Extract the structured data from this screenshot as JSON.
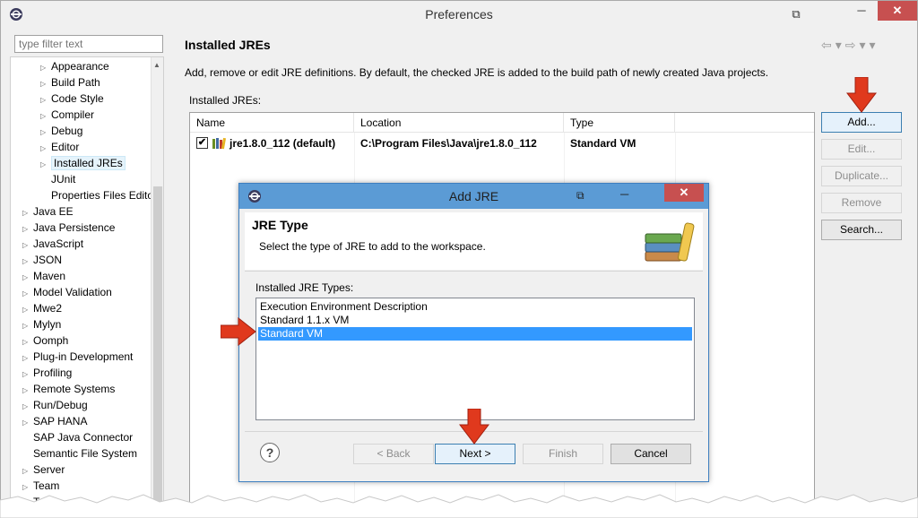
{
  "window": {
    "title": "Preferences",
    "min_glyph": "─",
    "max_glyph": "□",
    "close_glyph": "✕"
  },
  "filter": {
    "placeholder": "type filter text"
  },
  "tree": {
    "items": [
      {
        "label": "Appearance",
        "indent": 2,
        "expandable": true
      },
      {
        "label": "Build Path",
        "indent": 2,
        "expandable": true
      },
      {
        "label": "Code Style",
        "indent": 2,
        "expandable": true
      },
      {
        "label": "Compiler",
        "indent": 2,
        "expandable": true
      },
      {
        "label": "Debug",
        "indent": 2,
        "expandable": true
      },
      {
        "label": "Editor",
        "indent": 2,
        "expandable": true
      },
      {
        "label": "Installed JREs",
        "indent": 2,
        "expandable": true,
        "selected": true
      },
      {
        "label": "JUnit",
        "indent": 2,
        "expandable": false
      },
      {
        "label": "Properties Files Edito",
        "indent": 2,
        "expandable": false
      },
      {
        "label": "Java EE",
        "indent": 1,
        "expandable": true
      },
      {
        "label": "Java Persistence",
        "indent": 1,
        "expandable": true
      },
      {
        "label": "JavaScript",
        "indent": 1,
        "expandable": true
      },
      {
        "label": "JSON",
        "indent": 1,
        "expandable": true
      },
      {
        "label": "Maven",
        "indent": 1,
        "expandable": true
      },
      {
        "label": "Model Validation",
        "indent": 1,
        "expandable": true
      },
      {
        "label": "Mwe2",
        "indent": 1,
        "expandable": true
      },
      {
        "label": "Mylyn",
        "indent": 1,
        "expandable": true
      },
      {
        "label": "Oomph",
        "indent": 1,
        "expandable": true
      },
      {
        "label": "Plug-in Development",
        "indent": 1,
        "expandable": true
      },
      {
        "label": "Profiling",
        "indent": 1,
        "expandable": true
      },
      {
        "label": "Remote Systems",
        "indent": 1,
        "expandable": true
      },
      {
        "label": "Run/Debug",
        "indent": 1,
        "expandable": true
      },
      {
        "label": "SAP HANA",
        "indent": 1,
        "expandable": true
      },
      {
        "label": "SAP Java Connector",
        "indent": 1,
        "expandable": false
      },
      {
        "label": "Semantic File System",
        "indent": 1,
        "expandable": false
      },
      {
        "label": "Server",
        "indent": 1,
        "expandable": true
      },
      {
        "label": "Team",
        "indent": 1,
        "expandable": true
      },
      {
        "label": "Term",
        "indent": 1,
        "expandable": true
      }
    ]
  },
  "page": {
    "title": "Installed JREs",
    "description": "Add, remove or edit JRE definitions. By default, the checked JRE is added to the build path of newly created Java projects.",
    "table_label": "Installed JREs:",
    "columns": [
      "Name",
      "Location",
      "Type"
    ],
    "rows": [
      {
        "name": "jre1.8.0_112 (default)",
        "location": "C:\\Program Files\\Java\\jre1.8.0_112",
        "type": "Standard VM",
        "checked": true
      }
    ],
    "buttons": {
      "add": "Add...",
      "edit": "Edit...",
      "duplicate": "Duplicate...",
      "remove": "Remove",
      "search": "Search..."
    }
  },
  "dialog": {
    "title": "Add JRE",
    "header_title": "JRE Type",
    "header_subtitle": "Select the type of JRE to add to the workspace.",
    "list_label": "Installed JRE Types:",
    "options": [
      {
        "label": "Execution Environment Description",
        "selected": false
      },
      {
        "label": "Standard 1.1.x VM",
        "selected": false
      },
      {
        "label": "Standard VM",
        "selected": true
      }
    ],
    "buttons": {
      "back": "< Back",
      "next": "Next >",
      "finish": "Finish",
      "cancel": "Cancel"
    },
    "help_glyph": "?"
  },
  "colors": {
    "selection": "#3399ff",
    "dialog_titlebar": "#5b9bd5",
    "close_button": "#c75050",
    "annotation_arrow": "#e0391d"
  }
}
